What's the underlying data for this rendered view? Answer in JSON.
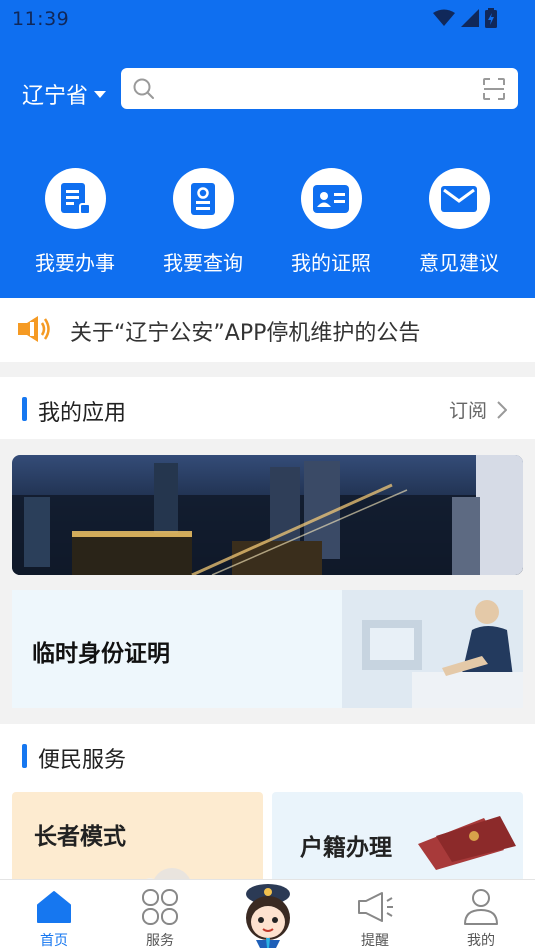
{
  "status_bar": {
    "time": "11:39"
  },
  "header": {
    "region_label": "辽宁省",
    "search_placeholder": "",
    "colors": {
      "brand_blue": "#0f6ff0",
      "accent_orange": "#f59a23"
    }
  },
  "quick_actions": [
    {
      "label": "我要办事",
      "icon": "document-icon"
    },
    {
      "label": "我要查询",
      "icon": "query-icon"
    },
    {
      "label": "我的证照",
      "icon": "id-card-icon"
    },
    {
      "label": "意见建议",
      "icon": "mail-icon"
    }
  ],
  "notice": {
    "text": "关于“辽宁公安”APP停机维护的公告",
    "icon": "speaker-icon"
  },
  "my_apps": {
    "title": "我的应用",
    "subscribe_label": "订阅"
  },
  "banner_card": {
    "title": "临时身份证明"
  },
  "services": {
    "title": "便民服务",
    "items": [
      {
        "label": "长者模式"
      },
      {
        "label": "户籍办理"
      }
    ]
  },
  "tabbar": {
    "items": [
      {
        "label": "首页",
        "icon": "home-icon",
        "active": true
      },
      {
        "label": "服务",
        "icon": "services-grid-icon",
        "active": false
      },
      {
        "label": "",
        "icon": "police-mascot-icon",
        "active": false
      },
      {
        "label": "提醒",
        "icon": "megaphone-icon",
        "active": false
      },
      {
        "label": "我的",
        "icon": "user-icon",
        "active": false
      }
    ]
  }
}
